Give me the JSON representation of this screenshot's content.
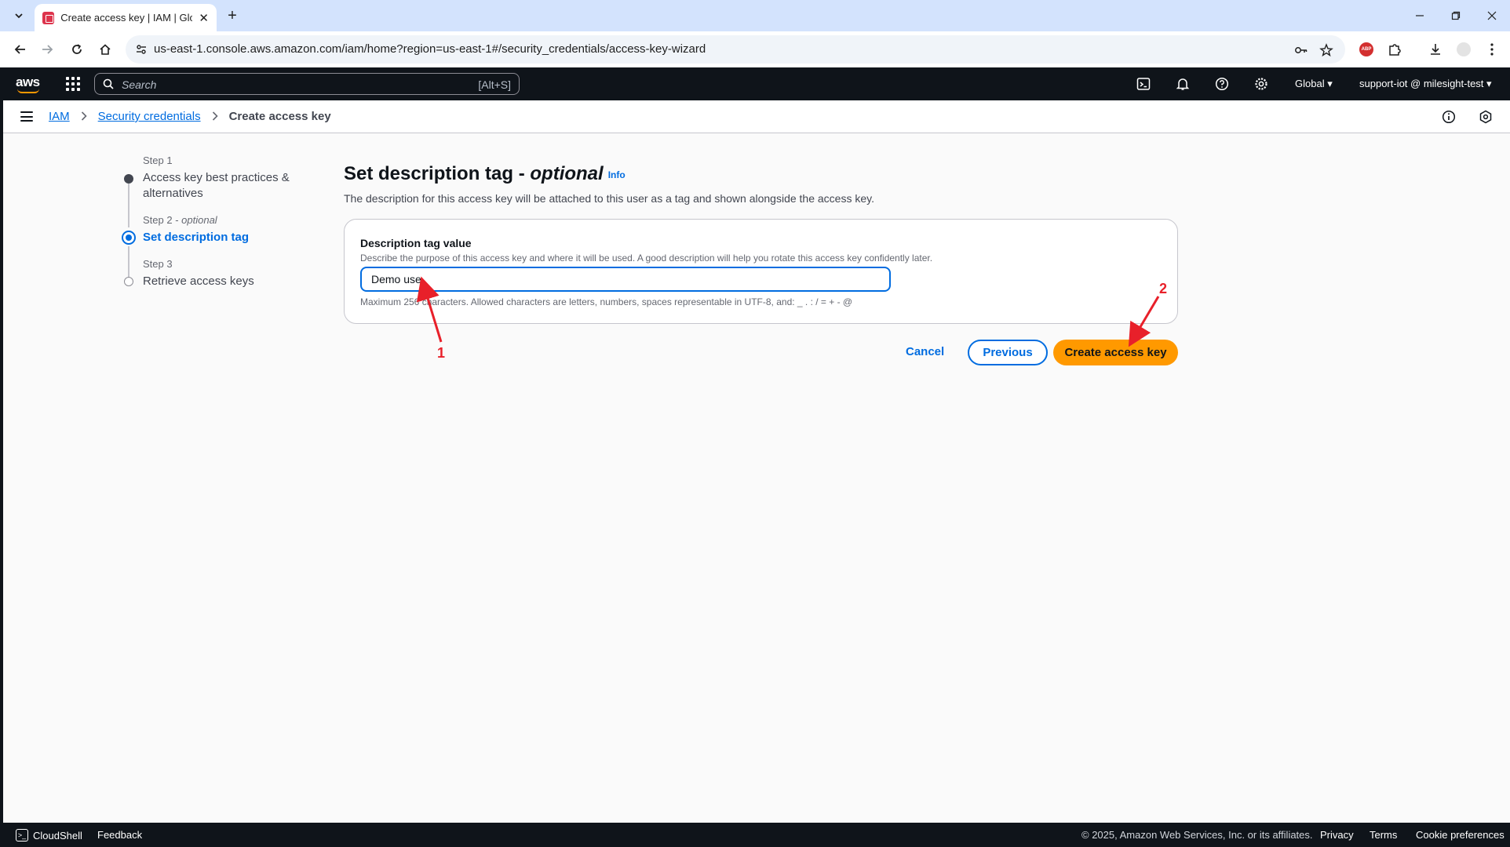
{
  "browser": {
    "tab_title": "Create access key | IAM | Glo",
    "url": "us-east-1.console.aws.amazon.com/iam/home?region=us-east-1#/security_credentials/access-key-wizard"
  },
  "aws_nav": {
    "search_placeholder": "Search",
    "search_shortcut": "[Alt+S]",
    "region": "Global ▾",
    "account": "support-iot @ milesight-test ▾"
  },
  "breadcrumb": {
    "items": [
      "IAM",
      "Security credentials",
      "Create access key"
    ]
  },
  "steps": [
    {
      "num": "Step 1",
      "label": "Access key best practices & alternatives",
      "state": "done"
    },
    {
      "num": "Step 2",
      "num_suffix": "optional",
      "label": "Set description tag",
      "state": "active"
    },
    {
      "num": "Step 3",
      "label": "Retrieve access keys",
      "state": "todo"
    }
  ],
  "main": {
    "title": "Set description tag - ",
    "title_optional": "optional",
    "info_link": "Info",
    "description": "The description for this access key will be attached to this user as a tag and shown alongside the access key.",
    "field": {
      "label": "Description tag value",
      "description": "Describe the purpose of this access key and where it will be used. A good description will help you rotate this access key confidently later.",
      "value": "Demo use",
      "constraint": "Maximum 256 characters. Allowed characters are letters, numbers, spaces representable in UTF-8, and: _ . : / = + - @"
    },
    "buttons": {
      "cancel": "Cancel",
      "previous": "Previous",
      "create": "Create access key"
    }
  },
  "annotations": {
    "arrow1_label": "1",
    "arrow2_label": "2",
    "color": "#e8202a"
  },
  "footer": {
    "cloudshell": "CloudShell",
    "feedback": "Feedback",
    "copyright": "© 2025, Amazon Web Services, Inc. or its affiliates.",
    "links": [
      "Privacy",
      "Terms",
      "Cookie preferences"
    ]
  },
  "colors": {
    "aws_dark": "#0f141a",
    "link_blue": "#006ce0",
    "primary_orange": "#ff9900"
  }
}
